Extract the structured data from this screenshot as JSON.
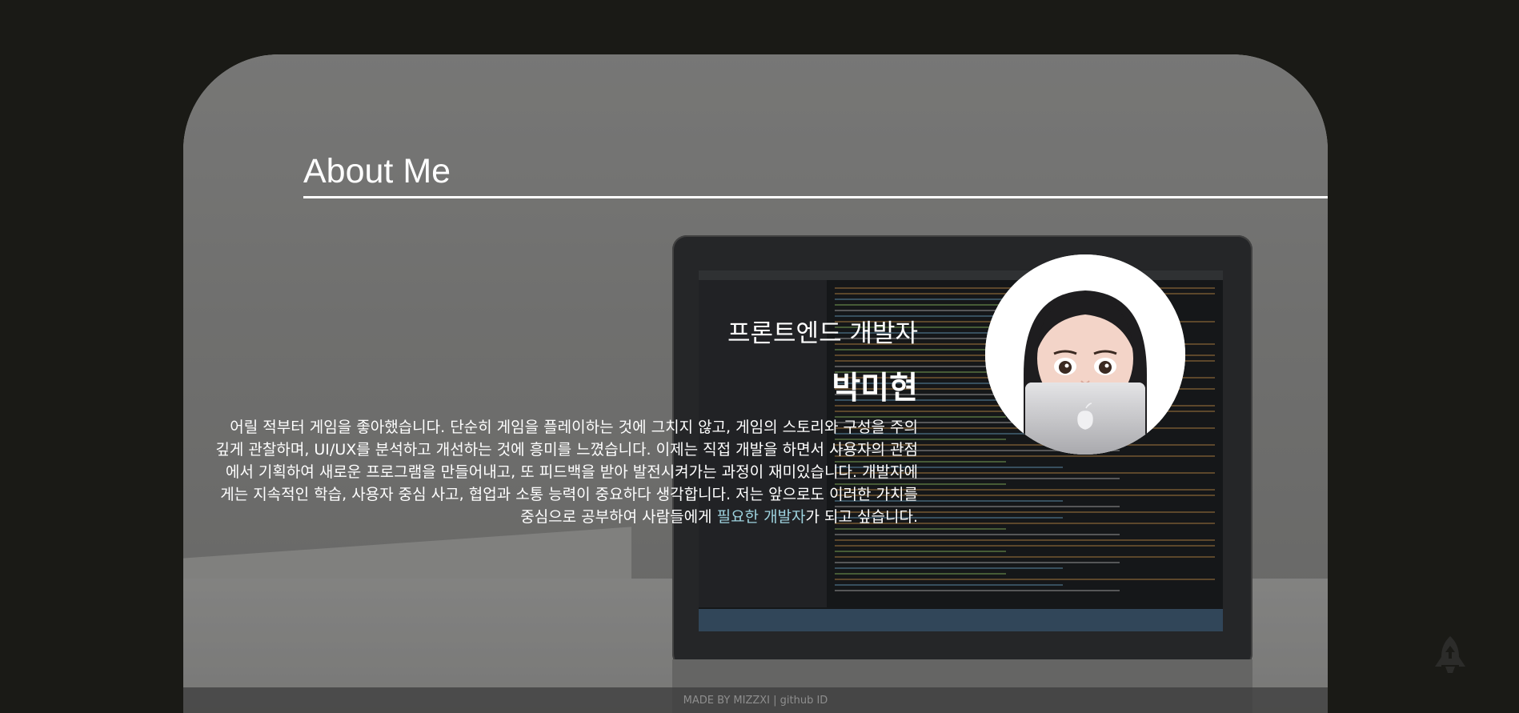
{
  "about": {
    "title": "About Me",
    "role": "프론트엔드 개발자",
    "name": "박미현",
    "intro_main": "어릴 적부터 게임을 좋아했습니다. 단순히 게임을 플레이하는 것에 그치지 않고, 게임의 스토리와 구성을 주의 깊게 관찰하며, UI/UX를 분석하고 개선하는 것에 흥미를 느꼈습니다. 이제는 직접 개발을 하면서 사용자의 관점에서 기획하여 새로운 프로그램을 만들어내고, 또 피드백을 받아 발전시켜가는 과정이 재미있습니다. 개발자에게는 지속적인 학습, 사용자 중심 사고, 협업과 소통 능력이 중요하다 생각합니다. 저는 앞으로도 이러한 가치를 중심으로 공부하여 사람들에게 ",
    "intro_highlight": "필요한 개발자",
    "intro_end": "가 되고 싶습니다."
  },
  "footer": {
    "text": "MADE BY MIZZXI | github ID"
  },
  "icons": {
    "back_to_top": "rocket-icon",
    "avatar": "memoji-avatar-with-laptop"
  },
  "colors": {
    "background": "#1a1a16",
    "highlight": "#9ed3df"
  }
}
